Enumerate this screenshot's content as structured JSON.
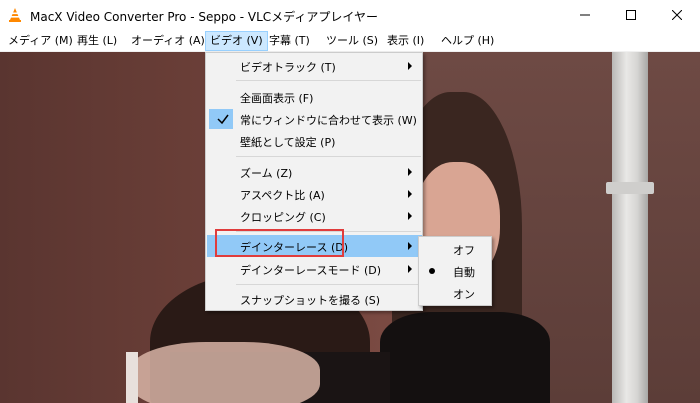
{
  "window": {
    "title": "MacX Video Converter Pro - Seppo - VLCメディアプレイヤー",
    "app_icon": "vlc-cone-icon",
    "controls": [
      "minimize-icon",
      "maximize-icon",
      "close-icon"
    ]
  },
  "menubar": {
    "items": [
      {
        "label": "メディア (M)"
      },
      {
        "label": "再生 (L)"
      },
      {
        "label": "オーディオ (A)"
      },
      {
        "label": "ビデオ (V)"
      },
      {
        "label": "字幕 (T)"
      },
      {
        "label": "ツール (S)"
      },
      {
        "label": "表示 (I)"
      },
      {
        "label": "ヘルプ (H)"
      }
    ]
  },
  "video_menu": {
    "items": [
      {
        "label": "ビデオトラック (T)",
        "submenu": true
      },
      {
        "label": "全画面表示 (F)"
      },
      {
        "label": "常にウィンドウに合わせて表示 (W)",
        "checked": true
      },
      {
        "label": "壁紙として設定 (P)"
      },
      {
        "label": "ズーム (Z)",
        "submenu": true
      },
      {
        "label": "アスペクト比 (A)",
        "submenu": true
      },
      {
        "label": "クロッピング (C)",
        "submenu": true
      },
      {
        "label": "デインターレース (D)",
        "submenu": true,
        "highlighted": true
      },
      {
        "label": "デインターレースモード (D)",
        "submenu": true
      },
      {
        "label": "スナップショットを撮る (S)"
      }
    ]
  },
  "deinterlace_submenu": {
    "items": [
      {
        "label": "オフ"
      },
      {
        "label": "自動",
        "selected": true
      },
      {
        "label": "オン"
      }
    ]
  },
  "colors": {
    "menu_highlight": "#91c9f7",
    "menubar_active": "#cce8ff",
    "annotation_box": "#e03c3c",
    "menu_background": "#f2f2f2"
  }
}
